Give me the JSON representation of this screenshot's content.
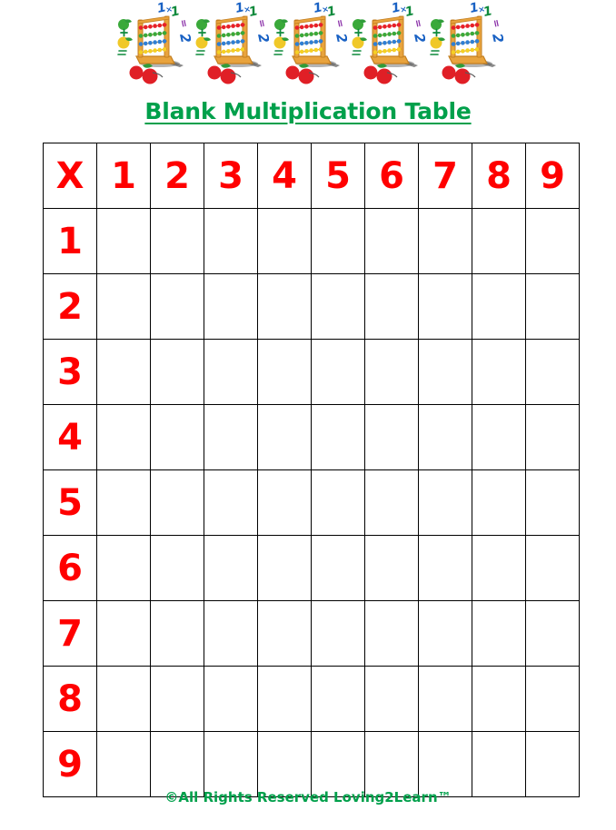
{
  "page": {
    "title": "Blank Multiplication Table",
    "footer_credit": "©All Rights Reserved Loving2Learn™"
  },
  "colors": {
    "title_green": "#00a04b",
    "number_red": "#ff0000",
    "grid_black": "#000000",
    "page_background": "#ffffff",
    "abacus_frame": "#e8a33d",
    "abacus_frame_dark": "#c47f20",
    "bead_red": "#e8202a",
    "bead_green": "#3aa93a",
    "bead_blue": "#2f7fd4",
    "bead_yellow": "#f5d023",
    "apple_red": "#e01f26",
    "leaf_green": "#2f9c3a",
    "pear_yellow": "#f0c828",
    "equation_blue": "#1a62c4",
    "equation_green": "#0f8a3c",
    "equation_purple": "#8a2fa8",
    "shadow_gray": "#5a5a5a"
  },
  "banner": {
    "name": "abacus-math-clipart-banner",
    "repeat_count": 5,
    "clipart_alt": "abacus with colored beads, apples, pear and 1x1=2 equation",
    "equation_text": {
      "one_a": "1",
      "times": "×",
      "one_b": "1",
      "equals": "=",
      "two": "2"
    }
  },
  "table": {
    "name": "blank-multiplication-grid",
    "corner_label": "X",
    "column_headers": [
      "1",
      "2",
      "3",
      "4",
      "5",
      "6",
      "7",
      "8",
      "9"
    ],
    "row_headers": [
      "1",
      "2",
      "3",
      "4",
      "5",
      "6",
      "7",
      "8",
      "9"
    ],
    "rows": [
      {
        "header": "1",
        "cells": [
          "",
          "",
          "",
          "",
          "",
          "",
          "",
          "",
          ""
        ]
      },
      {
        "header": "2",
        "cells": [
          "",
          "",
          "",
          "",
          "",
          "",
          "",
          "",
          ""
        ]
      },
      {
        "header": "3",
        "cells": [
          "",
          "",
          "",
          "",
          "",
          "",
          "",
          "",
          ""
        ]
      },
      {
        "header": "4",
        "cells": [
          "",
          "",
          "",
          "",
          "",
          "",
          "",
          "",
          ""
        ]
      },
      {
        "header": "5",
        "cells": [
          "",
          "",
          "",
          "",
          "",
          "",
          "",
          "",
          ""
        ]
      },
      {
        "header": "6",
        "cells": [
          "",
          "",
          "",
          "",
          "",
          "",
          "",
          "",
          ""
        ]
      },
      {
        "header": "7",
        "cells": [
          "",
          "",
          "",
          "",
          "",
          "",
          "",
          "",
          ""
        ]
      },
      {
        "header": "8",
        "cells": [
          "",
          "",
          "",
          "",
          "",
          "",
          "",
          "",
          ""
        ]
      },
      {
        "header": "9",
        "cells": [
          "",
          "",
          "",
          "",
          "",
          "",
          "",
          "",
          ""
        ]
      }
    ]
  }
}
